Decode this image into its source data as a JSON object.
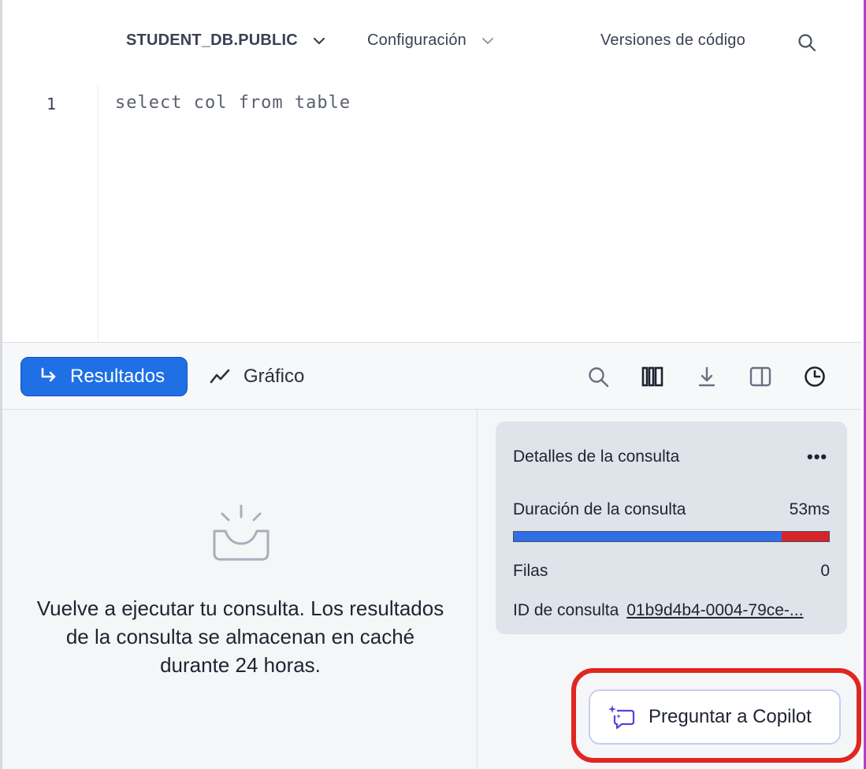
{
  "toolbar": {
    "database_context": "STUDENT_DB.PUBLIC",
    "settings_label": "Configuración",
    "code_versions_label": "Versiones de código",
    "search_icon": "search-icon"
  },
  "editor": {
    "line_numbers": [
      "1"
    ],
    "lines": [
      "select col from table"
    ]
  },
  "results_bar": {
    "results_tab_label": "Resultados",
    "chart_tab_label": "Gráfico",
    "icons": [
      "search-icon",
      "columns-icon",
      "download-icon",
      "split-pane-icon",
      "history-icon"
    ]
  },
  "empty_state": {
    "icon": "empty-tray-icon",
    "message": "Vuelve a ejecutar tu consulta. Los resultados de la consulta se almacenan en caché durante 24 horas."
  },
  "query_details": {
    "title": "Detalles de la consulta",
    "more_label": "•••",
    "duration_label": "Duración de la consulta",
    "duration_value": "53ms",
    "duration_bar": {
      "blue_fraction": 0.85,
      "colors": {
        "primary": "#2f6ee6",
        "secondary": "#d6232a"
      }
    },
    "rows_label": "Filas",
    "rows_value": "0",
    "query_id_label": "ID de consulta",
    "query_id_value": "01b9d4b4-0004-79ce-..."
  },
  "copilot": {
    "button_label": "Preguntar a Copilot",
    "highlight_color": "#e0261f"
  },
  "colors": {
    "accent": "#1f6fe5"
  }
}
